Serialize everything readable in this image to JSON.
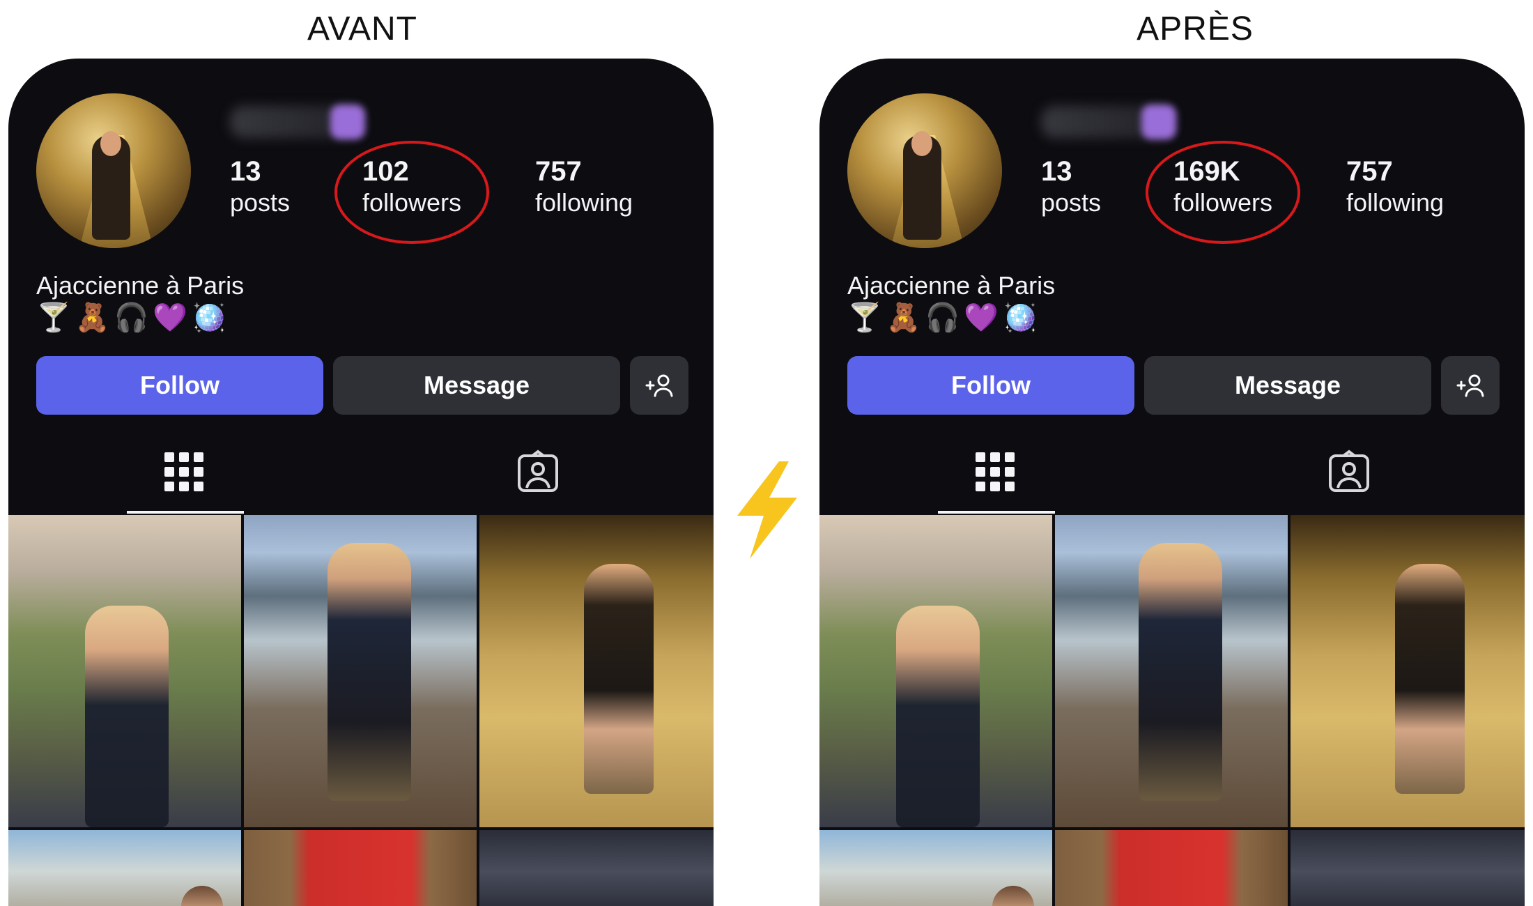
{
  "headings": {
    "before": "AVANT",
    "after": "APRÈS"
  },
  "profiles": [
    {
      "posts_count": "13",
      "posts_label": "posts",
      "followers_count": "102",
      "followers_label": "followers",
      "following_count": "757",
      "following_label": "following",
      "bio": "Ajaccienne à Paris",
      "emojis": "🍸🧸🎧💜🪩",
      "follow_label": "Follow",
      "message_label": "Message",
      "add_person_label": "+👤"
    },
    {
      "posts_count": "13",
      "posts_label": "posts",
      "followers_count": "169K",
      "followers_label": "followers",
      "following_count": "757",
      "following_label": "following",
      "bio": "Ajaccienne à Paris",
      "emojis": "🍸🧸🎧💜🪩",
      "follow_label": "Follow",
      "message_label": "Message",
      "add_person_label": "+👤"
    }
  ],
  "icons": {
    "grid_tab": "grid-icon",
    "tagged_tab": "tagged-person-icon",
    "add_person": "add-person-icon",
    "separator": "lightning-bolt-icon"
  },
  "colors": {
    "follow_button": "#5b63ea",
    "panel_background": "#0d0d11",
    "highlight_circle": "#d8191b",
    "bolt": "#f7c51e"
  }
}
